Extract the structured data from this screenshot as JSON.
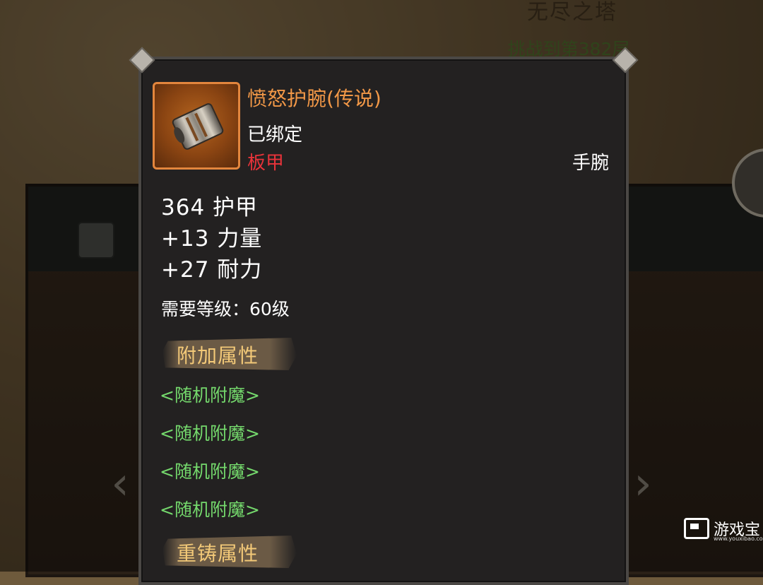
{
  "background": {
    "tower_title": "无尽之塔",
    "tower_progress": "挑战到第382层"
  },
  "item": {
    "name": "愤怒护腕(传说)",
    "bound_status": "已绑定",
    "armor_type": "板甲",
    "slot": "手腕",
    "icon": "bracer-icon",
    "rarity_color": "#f29847"
  },
  "stats": [
    "364 护甲",
    "+13 力量",
    "+27 耐力"
  ],
  "requirement": "需要等级：60级",
  "sections": {
    "extra_attributes_title": "附加属性",
    "reforge_attributes_title": "重铸属性"
  },
  "enchants": [
    "<随机附魔>",
    "<随机附魔>",
    "<随机附魔>",
    "<随机附魔>"
  ],
  "watermark": {
    "text": "游戏宝",
    "url_text": "www.youxibao.com"
  },
  "colors": {
    "enchant": "#74d86c",
    "armor_type": "#e8333a",
    "section_title": "#f3c978"
  }
}
